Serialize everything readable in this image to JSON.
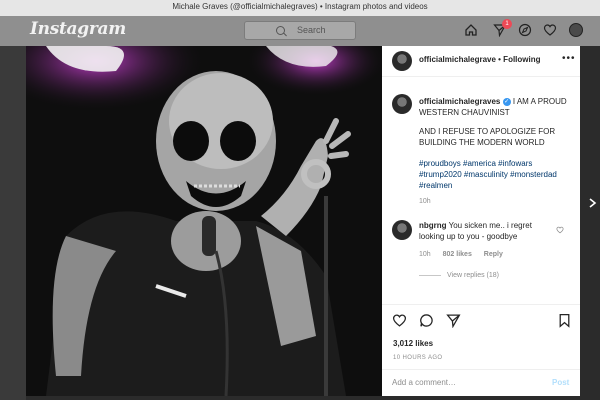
{
  "window": {
    "title": "Michale Graves (@officialmichalegraves) • Instagram photos and videos"
  },
  "topbar": {
    "logo": "Instagram",
    "search_placeholder": "Search",
    "activity_count": "1"
  },
  "post": {
    "header_username": "officialmichalegrave",
    "follow_status": "• Following",
    "caption_username": "officialmichalegraves",
    "caption_line1": "I AM A PROUD WESTERN CHAUVINIST",
    "caption_line2": "AND I REFUSE TO APOLOGIZE FOR BUILDING THE MODERN WORLD",
    "hashtags": "#proudboys #america #infowars #trump2020 #masculinity #monsterdad #realmen",
    "caption_time": "10h",
    "comment": {
      "username": "nbgrng",
      "text": "You sicken me.. i regret looking up to you - goodbye",
      "time": "10h",
      "likes": "802 likes",
      "reply": "Reply",
      "view_replies": "View replies (18)"
    },
    "likes": "3,012 likes",
    "time_ago": "10 HOURS AGO",
    "add_comment_placeholder": "Add a comment…",
    "post_button": "Post"
  },
  "colors": {
    "link": "#00376b",
    "verified": "#3897f0",
    "badge": "#ed4956",
    "post_button": "#b2dffc"
  }
}
